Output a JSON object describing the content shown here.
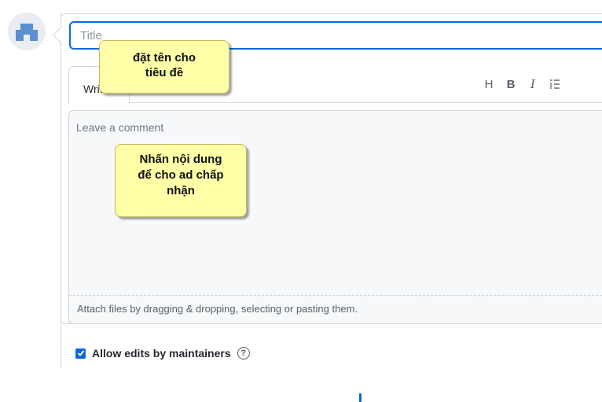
{
  "form": {
    "title_placeholder": "Title",
    "tab_write": "Write",
    "toolbar": {
      "heading": "H",
      "bold": "B",
      "italic": "I",
      "list": "⁝≡"
    },
    "comment_placeholder": "Leave a comment",
    "attach_text": "Attach files by dragging & dropping, selecting or pasting them.",
    "allow_edits_label": "Allow edits by maintainers",
    "allow_edits_checked": true,
    "help_glyph": "?"
  },
  "annotations": [
    {
      "text": "đặt tên cho\ntiêu đề"
    },
    {
      "text": "Nhấn nội dung\nđể cho ad chấp\nnhận"
    }
  ],
  "colors": {
    "accent": "#0969da",
    "callout_bg": "#ffffa8",
    "border": "#d0d7de",
    "comment_bg": "#f6f8fa"
  }
}
